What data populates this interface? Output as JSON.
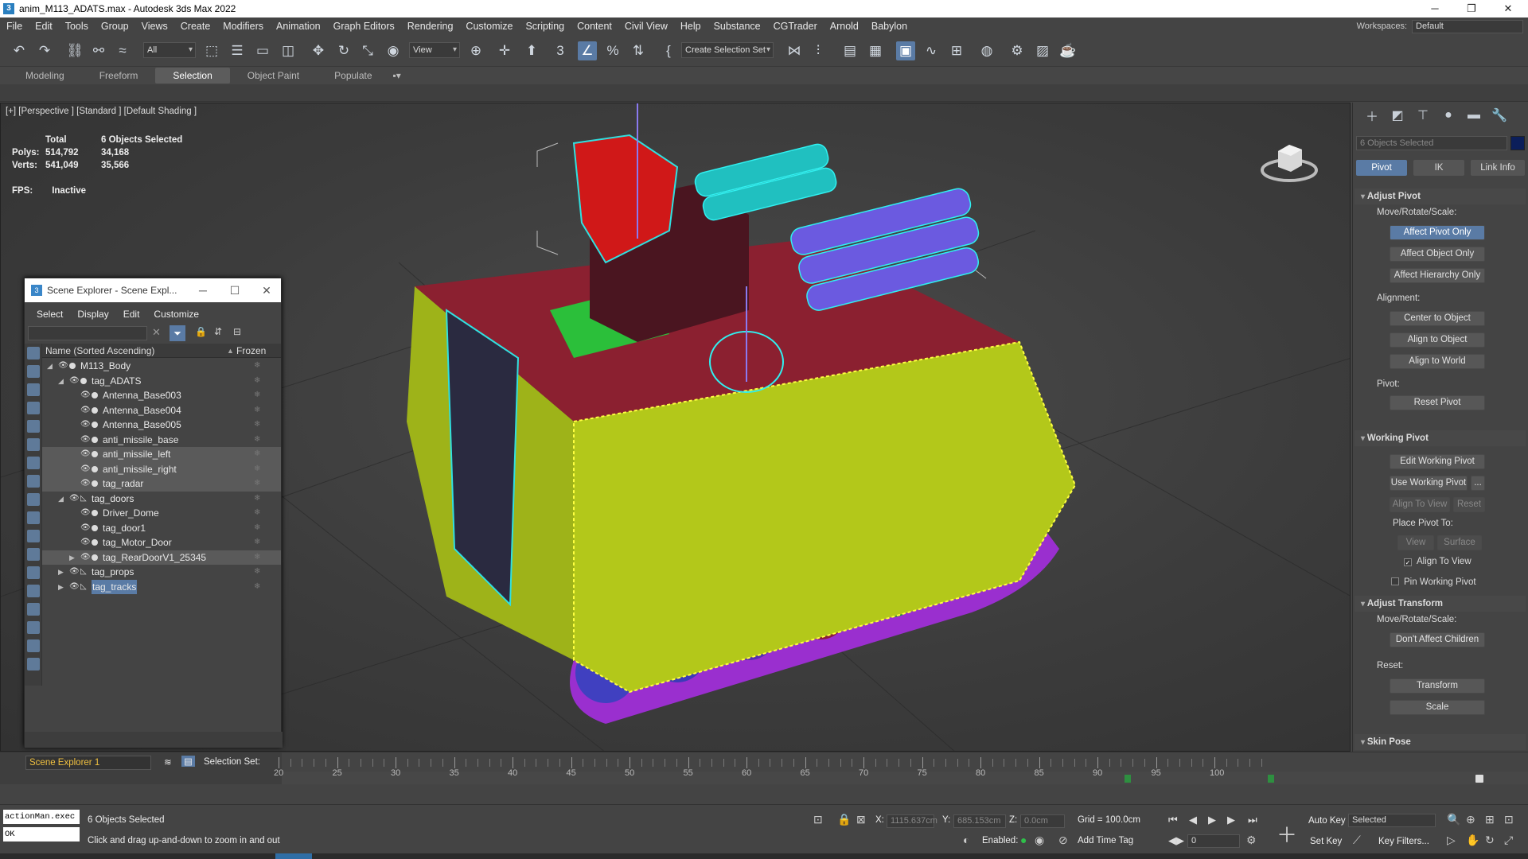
{
  "window": {
    "title": "anim_M113_ADATS.max - Autodesk 3ds Max 2022",
    "min": "─",
    "max": "❐",
    "close": "✕"
  },
  "menu": [
    "File",
    "Edit",
    "Tools",
    "Group",
    "Views",
    "Create",
    "Modifiers",
    "Animation",
    "Graph Editors",
    "Rendering",
    "Customize",
    "Scripting",
    "Content",
    "Civil View",
    "Help",
    "Substance",
    "CGTrader",
    "Arnold",
    "Babylon"
  ],
  "workspace": {
    "label": "Workspaces:",
    "value": "Default"
  },
  "toolbar": {
    "filter": "All",
    "refcoord": "View",
    "selset": "Create Selection Set"
  },
  "ribbon": {
    "tabs": [
      "Modeling",
      "Freeform",
      "Selection",
      "Object Paint",
      "Populate"
    ],
    "active": "Selection"
  },
  "viewport": {
    "label": "[+] [Perspective ] [Standard ] [Default Shading ]",
    "stats": {
      "total_label": "Total",
      "selected_label": "6 Objects Selected",
      "polys_label": "Polys:",
      "polys_total": "514,792",
      "polys_sel": "34,168",
      "verts_label": "Verts:",
      "verts_total": "541,049",
      "verts_sel": "35,566"
    },
    "fps_label": "FPS:",
    "fps_value": "Inactive"
  },
  "scene_explorer": {
    "title": "Scene Explorer - Scene Expl...",
    "menu": [
      "Select",
      "Display",
      "Edit",
      "Customize"
    ],
    "col_name": "Name (Sorted Ascending)",
    "col_sort": "▲",
    "col_frozen": "Frozen",
    "rows": [
      {
        "label": "M113_Body",
        "level": 0,
        "expanded": true,
        "layer": false
      },
      {
        "label": "tag_ADATS",
        "level": 1,
        "expanded": true,
        "layer": false
      },
      {
        "label": "Antenna_Base003",
        "level": 2
      },
      {
        "label": "Antenna_Base004",
        "level": 2
      },
      {
        "label": "Antenna_Base005",
        "level": 2
      },
      {
        "label": "anti_missile_base",
        "level": 2
      },
      {
        "label": "anti_missile_left",
        "level": 2,
        "selected": true
      },
      {
        "label": "anti_missile_right",
        "level": 2,
        "selected": true
      },
      {
        "label": "tag_radar",
        "level": 2,
        "selected": true
      },
      {
        "label": "tag_doors",
        "level": 1,
        "expanded": true,
        "layer": true
      },
      {
        "label": "Driver_Dome",
        "level": 2
      },
      {
        "label": "tag_door1",
        "level": 2
      },
      {
        "label": "tag_Motor_Door",
        "level": 2
      },
      {
        "label": "tag_RearDoorV1_25345",
        "level": 2,
        "selected": true,
        "collapsed": true
      },
      {
        "label": "tag_props",
        "level": 1,
        "collapsed": true,
        "layer": true
      },
      {
        "label": "tag_tracks",
        "level": 1,
        "collapsed": true,
        "layer": true,
        "highlight": true
      }
    ]
  },
  "command_panel": {
    "object_name": "6 Objects Selected",
    "subtabs": [
      "Pivot",
      "IK",
      "Link Info"
    ],
    "adjust_pivot": {
      "title": "Adjust Pivot",
      "mrs_label": "Move/Rotate/Scale:",
      "b1": "Affect Pivot Only",
      "b2": "Affect Object Only",
      "b3": "Affect Hierarchy Only",
      "align_label": "Alignment:",
      "b4": "Center to Object",
      "b5": "Align to Object",
      "b6": "Align to World",
      "pivot_label": "Pivot:",
      "b7": "Reset Pivot"
    },
    "working_pivot": {
      "title": "Working Pivot",
      "b1": "Edit Working Pivot",
      "b2": "Use Working Pivot",
      "b2x": "...",
      "b3": "Align To View",
      "b4": "Reset",
      "place_label": "Place Pivot To:",
      "b5": "View",
      "b6": "Surface",
      "c1": "Align To View",
      "c2": "Pin Working Pivot"
    },
    "adjust_transform": {
      "title": "Adjust Transform",
      "mrs_label": "Move/Rotate/Scale:",
      "b1": "Don't Affect Children",
      "reset_label": "Reset:",
      "b2": "Transform",
      "b3": "Scale"
    },
    "skin_pose": {
      "title": "Skin Pose"
    }
  },
  "timeline": {
    "explorer_name": "Scene Explorer 1",
    "selection_set": "Selection Set:",
    "ticks": [
      "20",
      "25",
      "30",
      "35",
      "40",
      "45",
      "50",
      "55",
      "60",
      "65",
      "70",
      "75",
      "80",
      "85",
      "90",
      "95",
      "100"
    ]
  },
  "status": {
    "maxscript": "actionMan.exec",
    "maxscript_out": "OK",
    "selected": "6 Objects Selected",
    "prompt": "Click and drag up-and-down to zoom in and out",
    "x_label": "X:",
    "x": "1115.637cm",
    "y_label": "Y:",
    "y": "685.153cm",
    "z_label": "Z:",
    "z": "0.0cm",
    "grid": "Grid = 100.0cm",
    "enabled": "Enabled:",
    "add_time_tag": "Add Time Tag",
    "frame": "0",
    "auto_key": "Auto Key",
    "set_key": "Set Key",
    "key_mode": "Selected",
    "key_filters": "Key Filters..."
  }
}
